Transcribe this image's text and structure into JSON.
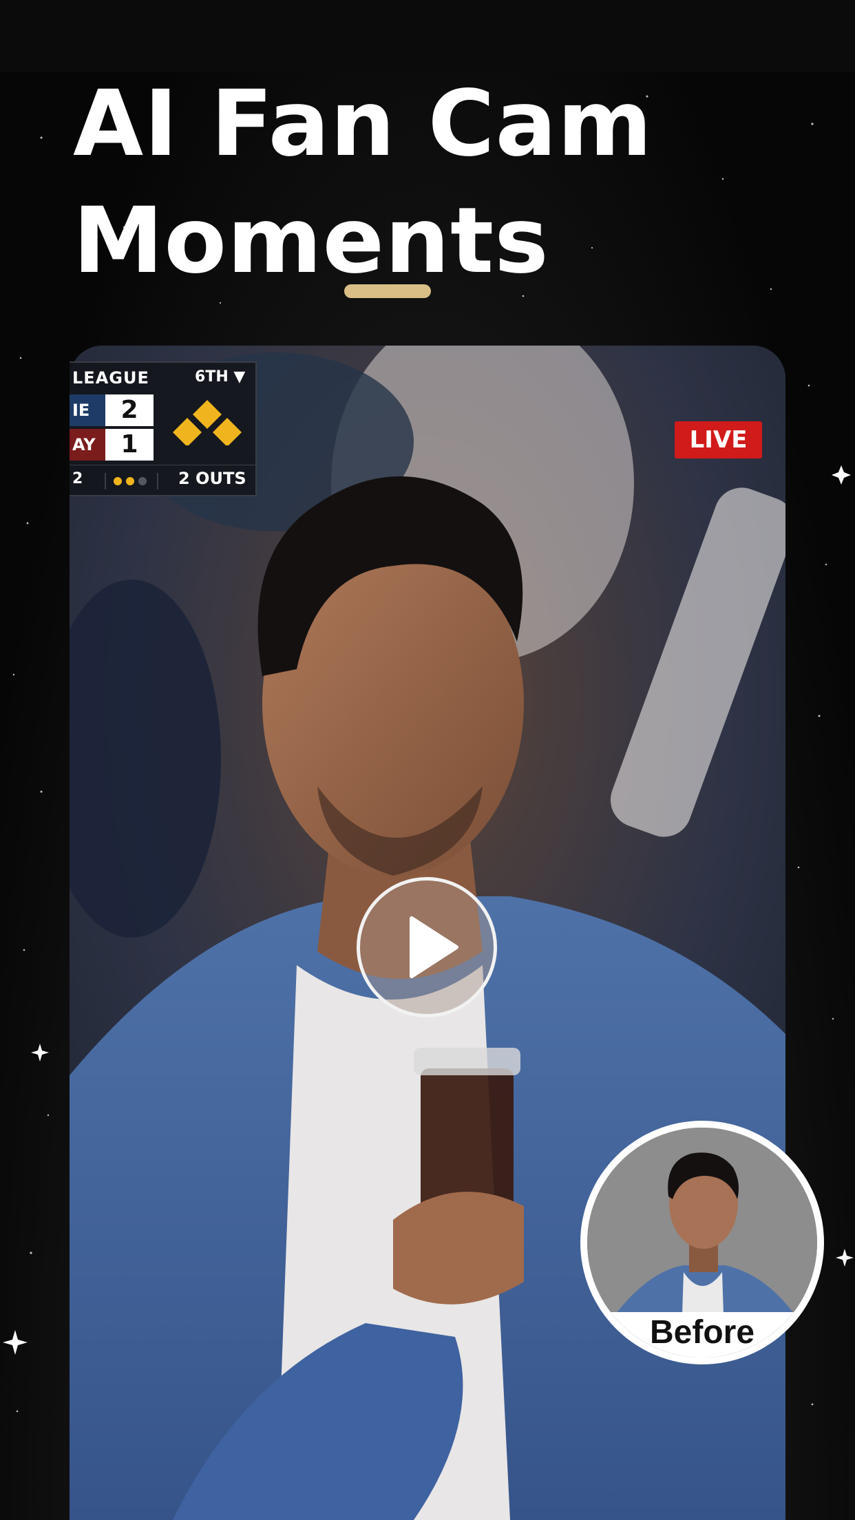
{
  "headline": {
    "line1": "AI Fan Cam",
    "line2": "Moments"
  },
  "colors": {
    "accent": "#d9bf86",
    "live_red": "#d11a1a",
    "background": "#050505"
  },
  "scoreboard": {
    "league": "LEAGUE",
    "inning": "6TH ▼",
    "home_label": "IE",
    "home_score": "2",
    "away_label": "AY",
    "away_score": "1",
    "inning_small": "2",
    "outs": "2 OUTS"
  },
  "live_badge": "LIVE",
  "play_icon": "play-icon",
  "before_label": "Before"
}
